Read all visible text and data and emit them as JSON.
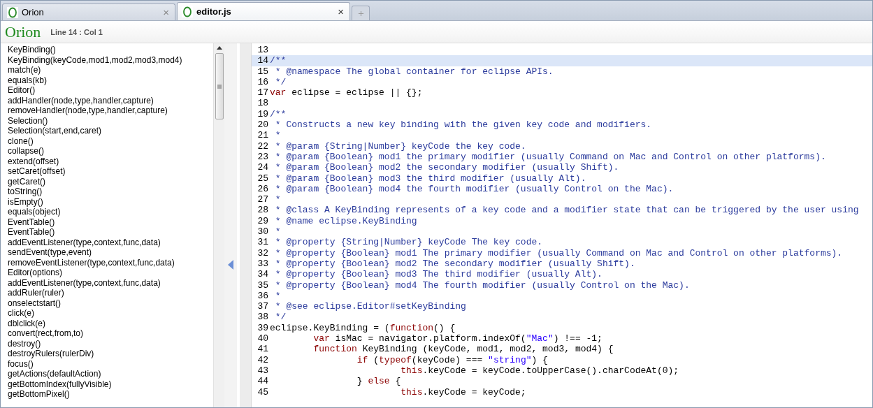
{
  "tabs": [
    {
      "label": "Orion",
      "selected": false,
      "close": "×"
    },
    {
      "label": "editor.js",
      "selected": true,
      "close": "×"
    }
  ],
  "header": {
    "logo": "Orion",
    "position": "Line 14 : Col 1"
  },
  "outline": {
    "items": [
      "KeyBinding()",
      "KeyBinding(keyCode,mod1,mod2,mod3,mod4)",
      "match(e)",
      "equals(kb)",
      "Editor()",
      "addHandler(node,type,handler,capture)",
      "removeHandler(node,type,handler,capture)",
      "Selection()",
      "Selection(start,end,caret)",
      "clone()",
      "collapse()",
      "extend(offset)",
      "setCaret(offset)",
      "getCaret()",
      "toString()",
      "isEmpty()",
      "equals(object)",
      "EventTable()",
      "EventTable()",
      "addEventListener(type,context,func,data)",
      "sendEvent(type,event)",
      "removeEventListener(type,context,func,data)",
      "Editor(options)",
      "addEventListener(type,context,func,data)",
      "addRuler(ruler)",
      "onselectstart()",
      "click(e)",
      "dblclick(e)",
      "convert(rect,from,to)",
      "destroy()",
      "destroyRulers(rulerDiv)",
      "focus()",
      "getActions(defaultAction)",
      "getBottomIndex(fullyVisible)",
      "getBottomPixel()"
    ]
  },
  "editor": {
    "lines": [
      {
        "number": "13",
        "current": false
      },
      {
        "number": "14",
        "current": true,
        "tokens": [
          {
            "kind": "comment",
            "text": "/**"
          }
        ]
      },
      {
        "number": "15",
        "current": false,
        "tokens": [
          {
            "kind": "comment",
            "text": " * @namespace The global container for eclipse APIs."
          }
        ]
      },
      {
        "number": "16",
        "current": false,
        "tokens": [
          {
            "kind": "comment",
            "text": " */"
          }
        ]
      },
      {
        "number": "17",
        "current": false,
        "tokens": [
          {
            "kind": "keyword",
            "text": "var"
          },
          {
            "kind": "text",
            "text": " eclipse = eclipse || {};"
          }
        ]
      },
      {
        "number": "18",
        "current": false
      },
      {
        "number": "19",
        "current": false,
        "tokens": [
          {
            "kind": "comment",
            "text": "/**"
          }
        ]
      },
      {
        "number": "20",
        "current": false,
        "tokens": [
          {
            "kind": "comment",
            "text": " * Constructs a new key binding with the given key code and modifiers."
          }
        ]
      },
      {
        "number": "21",
        "current": false,
        "tokens": [
          {
            "kind": "comment",
            "text": " *"
          }
        ]
      },
      {
        "number": "22",
        "current": false,
        "tokens": [
          {
            "kind": "comment",
            "text": " * @param {String|Number} keyCode the key code."
          }
        ]
      },
      {
        "number": "23",
        "current": false,
        "tokens": [
          {
            "kind": "comment",
            "text": " * @param {Boolean} mod1 the primary modifier (usually Command on Mac and Control on other platforms)."
          }
        ]
      },
      {
        "number": "24",
        "current": false,
        "tokens": [
          {
            "kind": "comment",
            "text": " * @param {Boolean} mod2 the secondary modifier (usually Shift)."
          }
        ]
      },
      {
        "number": "25",
        "current": false,
        "tokens": [
          {
            "kind": "comment",
            "text": " * @param {Boolean} mod3 the third modifier (usually Alt)."
          }
        ]
      },
      {
        "number": "26",
        "current": false,
        "tokens": [
          {
            "kind": "comment",
            "text": " * @param {Boolean} mod4 the fourth modifier (usually Control on the Mac)."
          }
        ]
      },
      {
        "number": "27",
        "current": false,
        "tokens": [
          {
            "kind": "comment",
            "text": " *"
          }
        ]
      },
      {
        "number": "28",
        "current": false,
        "tokens": [
          {
            "kind": "comment",
            "text": " * @class A KeyBinding represents of a key code and a modifier state that can be triggered by the user using"
          }
        ]
      },
      {
        "number": "29",
        "current": false,
        "tokens": [
          {
            "kind": "comment",
            "text": " * @name eclipse.KeyBinding"
          }
        ]
      },
      {
        "number": "30",
        "current": false,
        "tokens": [
          {
            "kind": "comment",
            "text": " *"
          }
        ]
      },
      {
        "number": "31",
        "current": false,
        "tokens": [
          {
            "kind": "comment",
            "text": " * @property {String|Number} keyCode The key code."
          }
        ]
      },
      {
        "number": "32",
        "current": false,
        "tokens": [
          {
            "kind": "comment",
            "text": " * @property {Boolean} mod1 The primary modifier (usually Command on Mac and Control on other platforms)."
          }
        ]
      },
      {
        "number": "33",
        "current": false,
        "tokens": [
          {
            "kind": "comment",
            "text": " * @property {Boolean} mod2 The secondary modifier (usually Shift)."
          }
        ]
      },
      {
        "number": "34",
        "current": false,
        "tokens": [
          {
            "kind": "comment",
            "text": " * @property {Boolean} mod3 The third modifier (usually Alt)."
          }
        ]
      },
      {
        "number": "35",
        "current": false,
        "tokens": [
          {
            "kind": "comment",
            "text": " * @property {Boolean} mod4 The fourth modifier (usually Control on the Mac)."
          }
        ]
      },
      {
        "number": "36",
        "current": false,
        "tokens": [
          {
            "kind": "comment",
            "text": " *"
          }
        ]
      },
      {
        "number": "37",
        "current": false,
        "tokens": [
          {
            "kind": "comment",
            "text": " * @see eclipse.Editor#setKeyBinding"
          }
        ]
      },
      {
        "number": "38",
        "current": false,
        "tokens": [
          {
            "kind": "comment",
            "text": " */"
          }
        ]
      },
      {
        "number": "39",
        "current": false,
        "tokens": [
          {
            "kind": "text",
            "text": "eclipse.KeyBinding = ("
          },
          {
            "kind": "keyword",
            "text": "function"
          },
          {
            "kind": "text",
            "text": "() {"
          }
        ]
      },
      {
        "number": "40",
        "current": false,
        "tokens": [
          {
            "kind": "keyword",
            "text": "        var"
          },
          {
            "kind": "text",
            "text": " isMac = navigator.platform.indexOf("
          },
          {
            "kind": "string",
            "text": "\"Mac\""
          },
          {
            "kind": "text",
            "text": ") !== -1;"
          }
        ]
      },
      {
        "number": "41",
        "current": false,
        "tokens": [
          {
            "kind": "keyword",
            "text": "        function"
          },
          {
            "kind": "text",
            "text": " KeyBinding (keyCode, mod1, mod2, mod3, mod4) {"
          }
        ]
      },
      {
        "number": "42",
        "current": false,
        "tokens": [
          {
            "kind": "keyword",
            "text": "                if"
          },
          {
            "kind": "text",
            "text": " ("
          },
          {
            "kind": "keyword",
            "text": "typeof"
          },
          {
            "kind": "text",
            "text": "(keyCode) === "
          },
          {
            "kind": "string",
            "text": "\"string\""
          },
          {
            "kind": "text",
            "text": ") {"
          }
        ]
      },
      {
        "number": "43",
        "current": false,
        "tokens": [
          {
            "kind": "keyword",
            "text": "                        this"
          },
          {
            "kind": "text",
            "text": ".keyCode = keyCode.toUpperCase().charCodeAt(0);"
          }
        ]
      },
      {
        "number": "44",
        "current": false,
        "tokens": [
          {
            "kind": "text",
            "text": "                } "
          },
          {
            "kind": "keyword",
            "text": "else"
          },
          {
            "kind": "text",
            "text": " {"
          }
        ]
      },
      {
        "number": "45",
        "current": false,
        "tokens": [
          {
            "kind": "keyword",
            "text": "                        this"
          },
          {
            "kind": "text",
            "text": ".keyCode = keyCode;"
          }
        ]
      }
    ]
  }
}
